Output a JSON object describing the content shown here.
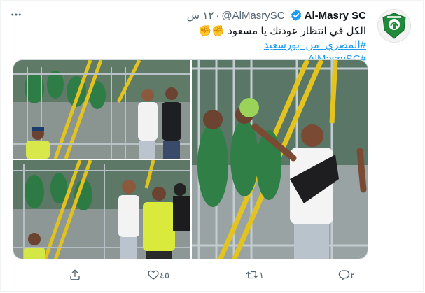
{
  "tweet": {
    "author_name": "Al-Masry SC",
    "handle": "@AlMasrySC",
    "separator": "·",
    "time": "١٢ س",
    "text_line1": "الكل في انتظار عودتك يا مسعود",
    "emoji": "✊",
    "hashtag1": "#المصري_من_بورسعيد",
    "hashtag2": "#AlMasrySC"
  },
  "actions": {
    "reply_count": "٢",
    "retweet_count": "١",
    "like_count": "٤٥"
  },
  "icons": {
    "verified": "verified-badge-icon",
    "more": "more-options-icon",
    "reply": "reply-icon",
    "retweet": "retweet-icon",
    "like": "heart-icon",
    "share": "share-icon"
  },
  "colors": {
    "text": "#0f1419",
    "secondary": "#536471",
    "link": "#1d9bf0",
    "verified": "#1d9bf0",
    "club_green": "#1f8a3b"
  }
}
